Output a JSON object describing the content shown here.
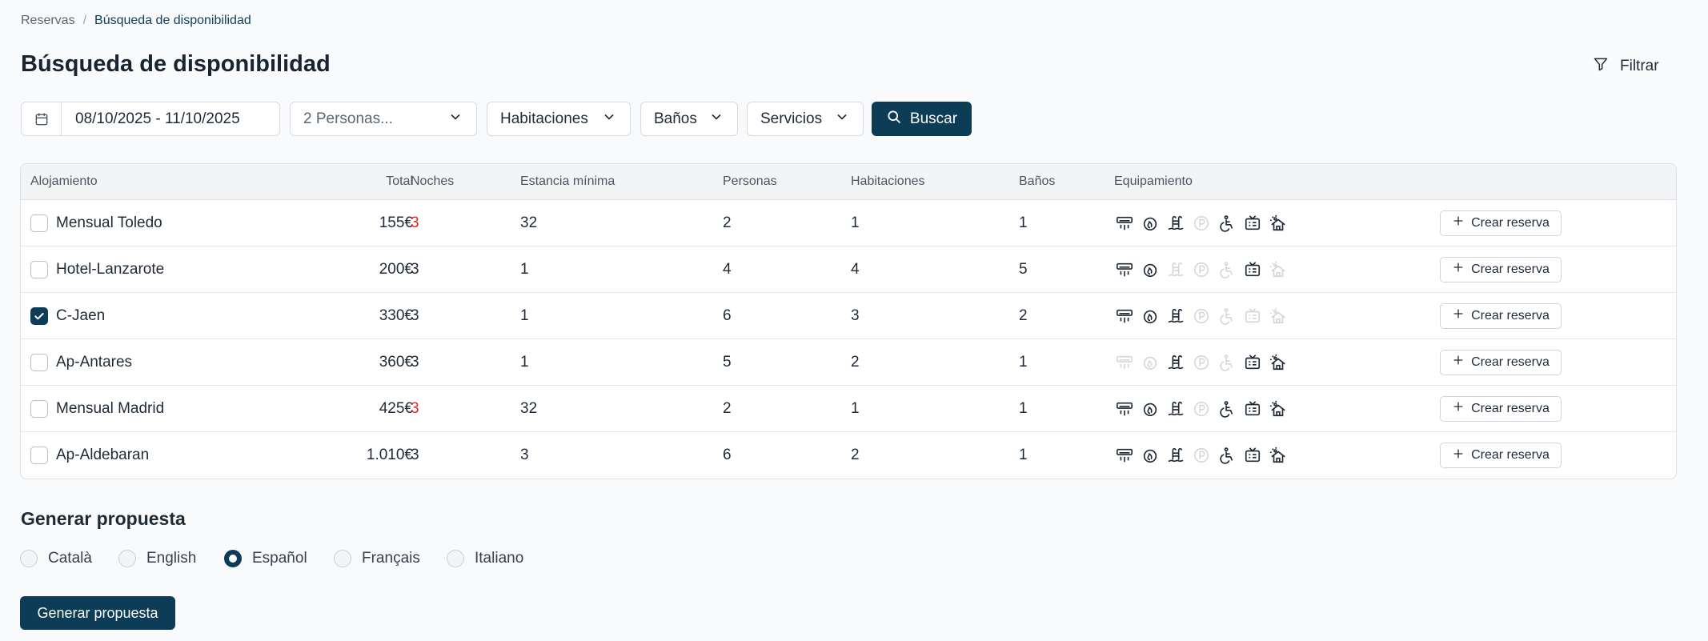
{
  "breadcrumb": {
    "root": "Reservas",
    "separator": "/",
    "current": "Búsqueda de disponibilidad"
  },
  "page": {
    "title": "Búsqueda de disponibilidad",
    "filter_label": "Filtrar"
  },
  "toolbar": {
    "date_range": "08/10/2025 - 11/10/2025",
    "persons": "2 Personas...",
    "rooms": "Habitaciones",
    "baths": "Baños",
    "services": "Servicios",
    "search": "Buscar"
  },
  "table": {
    "headers": {
      "name": "Alojamiento",
      "total": "Total",
      "nights": "Noches",
      "min_stay": "Estancia mínima",
      "persons": "Personas",
      "rooms": "Habitaciones",
      "baths": "Baños",
      "equipment": "Equipamiento"
    },
    "create_label": "Crear reserva",
    "equipment_icons": [
      "air-conditioning-icon",
      "heating-icon",
      "pool-icon",
      "parking-icon",
      "accessible-icon",
      "tv-icon",
      "terrace-icon"
    ],
    "rows": [
      {
        "name": "Mensual Toledo",
        "checked": false,
        "total": "155€",
        "nights": "3",
        "nights_warn": true,
        "min_stay": "32",
        "persons": "2",
        "rooms": "1",
        "baths": "1",
        "equipment": [
          true,
          true,
          true,
          false,
          true,
          true,
          true
        ]
      },
      {
        "name": "Hotel-Lanzarote",
        "checked": false,
        "total": "200€",
        "nights": "3",
        "nights_warn": false,
        "min_stay": "1",
        "persons": "4",
        "rooms": "4",
        "baths": "5",
        "equipment": [
          true,
          true,
          false,
          false,
          false,
          true,
          false
        ]
      },
      {
        "name": "C-Jaen",
        "checked": true,
        "total": "330€",
        "nights": "3",
        "nights_warn": false,
        "min_stay": "1",
        "persons": "6",
        "rooms": "3",
        "baths": "2",
        "equipment": [
          true,
          true,
          true,
          false,
          false,
          false,
          false
        ]
      },
      {
        "name": "Ap-Antares",
        "checked": false,
        "total": "360€",
        "nights": "3",
        "nights_warn": false,
        "min_stay": "1",
        "persons": "5",
        "rooms": "2",
        "baths": "1",
        "equipment": [
          false,
          false,
          true,
          false,
          false,
          true,
          true
        ]
      },
      {
        "name": "Mensual Madrid",
        "checked": false,
        "total": "425€",
        "nights": "3",
        "nights_warn": true,
        "min_stay": "32",
        "persons": "2",
        "rooms": "1",
        "baths": "1",
        "equipment": [
          true,
          true,
          true,
          false,
          true,
          true,
          true
        ]
      },
      {
        "name": "Ap-Aldebaran",
        "checked": false,
        "total": "1.010€",
        "nights": "3",
        "nights_warn": false,
        "min_stay": "3",
        "persons": "6",
        "rooms": "2",
        "baths": "1",
        "equipment": [
          true,
          true,
          true,
          false,
          true,
          true,
          true
        ]
      }
    ]
  },
  "proposal": {
    "title": "Generar propuesta",
    "languages": [
      {
        "label": "Català",
        "selected": false
      },
      {
        "label": "English",
        "selected": false
      },
      {
        "label": "Español",
        "selected": true
      },
      {
        "label": "Français",
        "selected": false
      },
      {
        "label": "Italiano",
        "selected": false
      }
    ],
    "button": "Generar propuesta"
  },
  "colors": {
    "primary": "#0c3c56",
    "warning": "#dc2626",
    "background": "#f8fafc"
  }
}
